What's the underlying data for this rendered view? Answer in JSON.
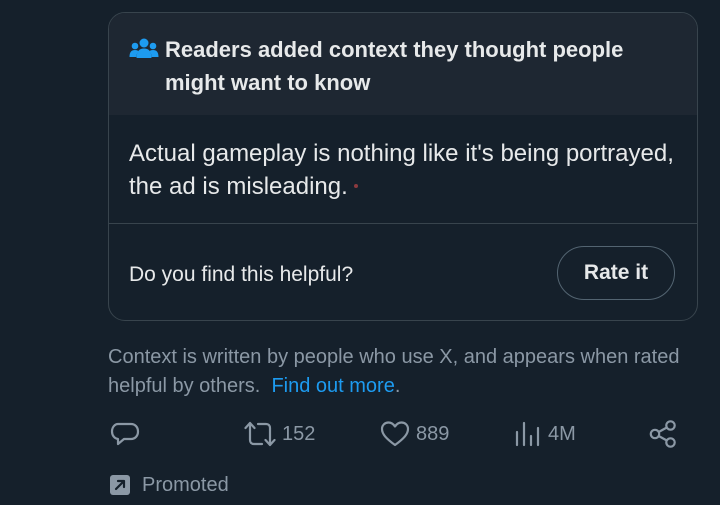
{
  "community_note": {
    "title": "Readers added context they thought people might want to know",
    "body": "Actual gameplay is nothing like it's being portrayed, the ad is misleading.",
    "helpful_question": "Do you find this helpful?",
    "rate_button_label": "Rate it"
  },
  "context_info": {
    "text": "Context is written by people who use X, and appears when rated helpful by others.",
    "link_label": "Find out more",
    "link_suffix": "."
  },
  "actions": {
    "reply_icon": "reply-icon",
    "repost_icon": "repost-icon",
    "repost_count": "152",
    "like_icon": "heart-icon",
    "like_count": "889",
    "views_icon": "analytics-icon",
    "views_count": "4M",
    "share_icon": "share-icon"
  },
  "promoted": {
    "icon": "promoted-arrow-icon",
    "label": "Promoted"
  },
  "colors": {
    "background": "#15202b",
    "header_background": "#1e2732",
    "border": "#38444d",
    "secondary_text": "#8b98a5",
    "link": "#1d9bf0",
    "people_icon": "#1d9bf0"
  }
}
